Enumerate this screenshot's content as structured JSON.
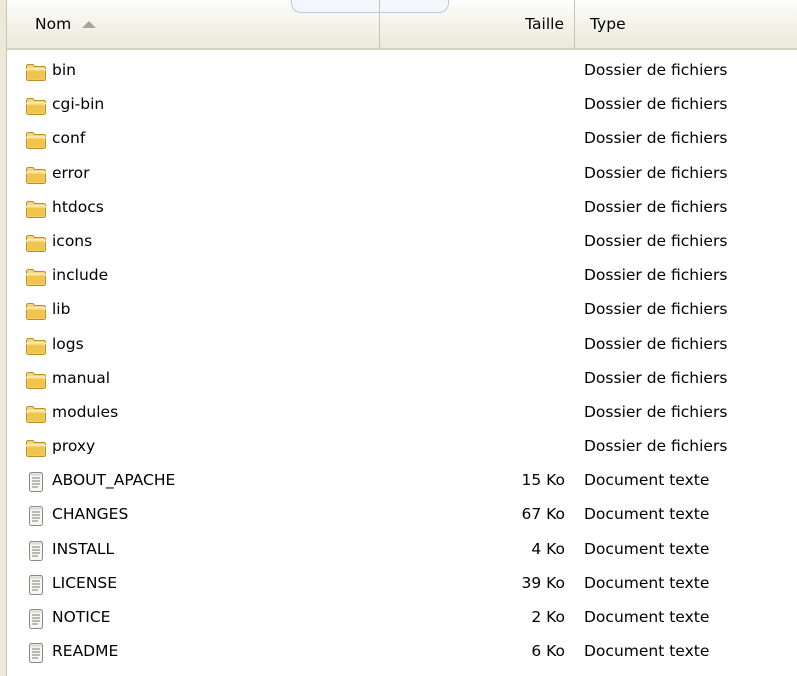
{
  "columns": {
    "name": "Nom",
    "size": "Taille",
    "type": "Type"
  },
  "rows": [
    {
      "name": "bin",
      "size": "",
      "type": "Dossier de fichiers",
      "icon": "folder-icon"
    },
    {
      "name": "cgi-bin",
      "size": "",
      "type": "Dossier de fichiers",
      "icon": "folder-icon"
    },
    {
      "name": "conf",
      "size": "",
      "type": "Dossier de fichiers",
      "icon": "folder-icon"
    },
    {
      "name": "error",
      "size": "",
      "type": "Dossier de fichiers",
      "icon": "folder-icon"
    },
    {
      "name": "htdocs",
      "size": "",
      "type": "Dossier de fichiers",
      "icon": "folder-icon"
    },
    {
      "name": "icons",
      "size": "",
      "type": "Dossier de fichiers",
      "icon": "folder-icon"
    },
    {
      "name": "include",
      "size": "",
      "type": "Dossier de fichiers",
      "icon": "folder-icon"
    },
    {
      "name": "lib",
      "size": "",
      "type": "Dossier de fichiers",
      "icon": "folder-icon"
    },
    {
      "name": "logs",
      "size": "",
      "type": "Dossier de fichiers",
      "icon": "folder-icon"
    },
    {
      "name": "manual",
      "size": "",
      "type": "Dossier de fichiers",
      "icon": "folder-icon"
    },
    {
      "name": "modules",
      "size": "",
      "type": "Dossier de fichiers",
      "icon": "folder-icon"
    },
    {
      "name": "proxy",
      "size": "",
      "type": "Dossier de fichiers",
      "icon": "folder-icon"
    },
    {
      "name": "ABOUT_APACHE",
      "size": "15 Ko",
      "type": "Document texte",
      "icon": "text-document-icon"
    },
    {
      "name": "CHANGES",
      "size": "67 Ko",
      "type": "Document texte",
      "icon": "text-document-icon"
    },
    {
      "name": "INSTALL",
      "size": "4 Ko",
      "type": "Document texte",
      "icon": "text-document-icon"
    },
    {
      "name": "LICENSE",
      "size": "39 Ko",
      "type": "Document texte",
      "icon": "text-document-icon"
    },
    {
      "name": "NOTICE",
      "size": "2 Ko",
      "type": "Document texte",
      "icon": "text-document-icon"
    },
    {
      "name": "README",
      "size": "6 Ko",
      "type": "Document texte",
      "icon": "text-document-icon"
    }
  ],
  "sort": {
    "column": "name",
    "direction": "ascending"
  }
}
